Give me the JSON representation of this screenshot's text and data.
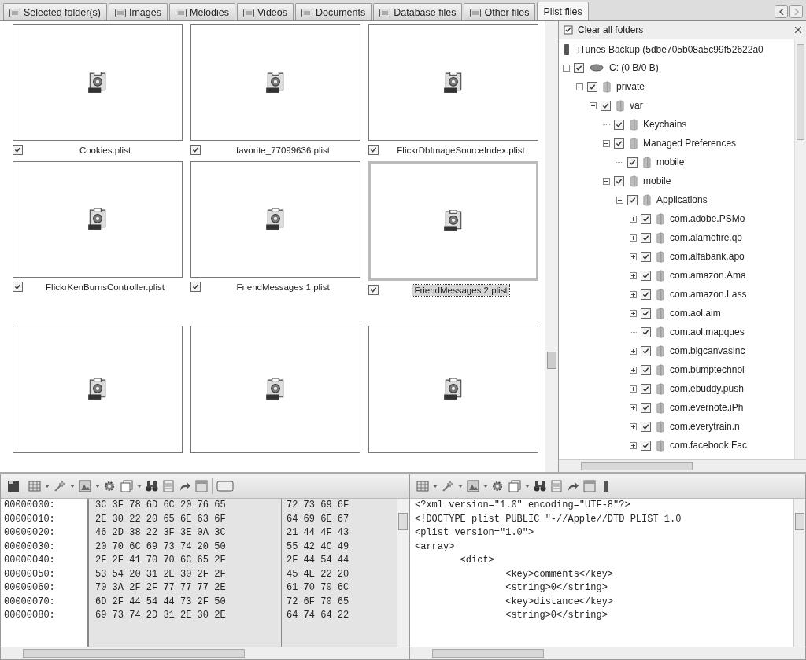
{
  "tabs": [
    {
      "label": "Selected folder(s)",
      "kind": "icon",
      "selected": false
    },
    {
      "label": "Images",
      "kind": "icon",
      "selected": false
    },
    {
      "label": "Melodies",
      "kind": "icon",
      "selected": false
    },
    {
      "label": "Videos",
      "kind": "icon",
      "selected": false
    },
    {
      "label": "Documents",
      "kind": "icon",
      "selected": false
    },
    {
      "label": "Database files",
      "kind": "icon",
      "selected": false
    },
    {
      "label": "Other files",
      "kind": "icon",
      "selected": false
    },
    {
      "label": "Plist files",
      "kind": "text",
      "selected": true
    }
  ],
  "files": [
    {
      "name": "Cookies.plist",
      "checked": true,
      "selected": false
    },
    {
      "name": "favorite_77099636.plist",
      "checked": true,
      "selected": false
    },
    {
      "name": "FlickrDbImageSourceIndex.plist",
      "checked": true,
      "selected": false
    },
    {
      "name": "FlickrKenBurnsController.plist",
      "checked": true,
      "selected": false
    },
    {
      "name": "FriendMessages 1.plist",
      "checked": true,
      "selected": false
    },
    {
      "name": "FriendMessages 2.plist",
      "checked": true,
      "selected": true
    },
    {
      "selected": false
    },
    {
      "selected": false
    },
    {
      "selected": false
    }
  ],
  "folders_panel": {
    "clear_label": "Clear all folders",
    "backup_label": "iTunes Backup (5dbe705b08a5c99f52622a0",
    "tree": [
      {
        "label": "C: (0 B/0 B)",
        "kind": "drive",
        "checked": true,
        "expanded": true,
        "children": [
          {
            "label": "private",
            "kind": "folder",
            "checked": true,
            "expanded": true,
            "children": [
              {
                "label": "var",
                "kind": "folder",
                "checked": true,
                "expanded": true,
                "children": [
                  {
                    "label": "Keychains",
                    "kind": "folder",
                    "checked": true
                  },
                  {
                    "label": "Managed Preferences",
                    "kind": "folder",
                    "checked": true,
                    "expanded": true,
                    "children": [
                      {
                        "label": "mobile",
                        "kind": "folder",
                        "checked": true
                      }
                    ]
                  },
                  {
                    "label": "mobile",
                    "kind": "folder",
                    "checked": true,
                    "expanded": true,
                    "children": [
                      {
                        "label": "Applications",
                        "kind": "folder",
                        "checked": true,
                        "expanded": true,
                        "children": [
                          {
                            "label": "com.adobe.PSMo",
                            "kind": "folder",
                            "checked": true,
                            "expanded": false
                          },
                          {
                            "label": "com.alamofire.qo",
                            "kind": "folder",
                            "checked": true,
                            "expanded": false
                          },
                          {
                            "label": "com.alfabank.apo",
                            "kind": "folder",
                            "checked": true,
                            "expanded": false
                          },
                          {
                            "label": "com.amazon.Ama",
                            "kind": "folder",
                            "checked": true,
                            "expanded": false
                          },
                          {
                            "label": "com.amazon.Lass",
                            "kind": "folder",
                            "checked": true,
                            "expanded": false
                          },
                          {
                            "label": "com.aol.aim",
                            "kind": "folder",
                            "checked": true,
                            "expanded": false
                          },
                          {
                            "label": "com.aol.mapques",
                            "kind": "folder",
                            "checked": true
                          },
                          {
                            "label": "com.bigcanvasinc",
                            "kind": "folder",
                            "checked": true,
                            "expanded": false
                          },
                          {
                            "label": "com.bumptechnol",
                            "kind": "folder",
                            "checked": true,
                            "expanded": false
                          },
                          {
                            "label": "com.ebuddy.push",
                            "kind": "folder",
                            "checked": true,
                            "expanded": false
                          },
                          {
                            "label": "com.evernote.iPh",
                            "kind": "folder",
                            "checked": true,
                            "expanded": false
                          },
                          {
                            "label": "com.everytrain.n",
                            "kind": "folder",
                            "checked": true,
                            "expanded": false
                          },
                          {
                            "label": "com.facebook.Fac",
                            "kind": "folder",
                            "checked": true,
                            "expanded": false
                          }
                        ]
                      }
                    ]
                  }
                ]
              }
            ]
          }
        ]
      }
    ]
  },
  "hex_view": {
    "rows": [
      {
        "offset": "00000000:",
        "bytes_a": "3C 3F 78 6D 6C 20 76 65",
        "bytes_b": "72 73 69 6F"
      },
      {
        "offset": "00000010:",
        "bytes_a": "2E 30 22 20 65 6E 63 6F",
        "bytes_b": "64 69 6E 67"
      },
      {
        "offset": "00000020:",
        "bytes_a": "46 2D 38 22 3F 3E 0A 3C",
        "bytes_b": "21 44 4F 43"
      },
      {
        "offset": "00000030:",
        "bytes_a": "20 70 6C 69 73 74 20 50",
        "bytes_b": "55 42 4C 49"
      },
      {
        "offset": "00000040:",
        "bytes_a": "2F 2F 41 70 70 6C 65 2F",
        "bytes_b": "2F 44 54 44"
      },
      {
        "offset": "00000050:",
        "bytes_a": "53 54 20 31 2E 30 2F 2F",
        "bytes_b": "45 4E 22 20"
      },
      {
        "offset": "00000060:",
        "bytes_a": "70 3A 2F 2F 77 77 77 2E",
        "bytes_b": "61 70 70 6C"
      },
      {
        "offset": "00000070:",
        "bytes_a": "6D 2F 44 54 44 73 2F 50",
        "bytes_b": "72 6F 70 65"
      },
      {
        "offset": "00000080:",
        "bytes_a": "69 73 74 2D 31 2E 30 2E",
        "bytes_b": "64 74 64 22"
      }
    ]
  },
  "text_view": {
    "lines": [
      "<?xml version=\"1.0\" encoding=\"UTF-8\"?>",
      "<!DOCTYPE plist PUBLIC \"-//Apple//DTD PLIST 1.0",
      "<plist version=\"1.0\">",
      "<array>",
      "        <dict>",
      "                <key>comments</key>",
      "                <string>0</string>",
      "                <key>distance</key>",
      "                <string>0</string>"
    ]
  }
}
